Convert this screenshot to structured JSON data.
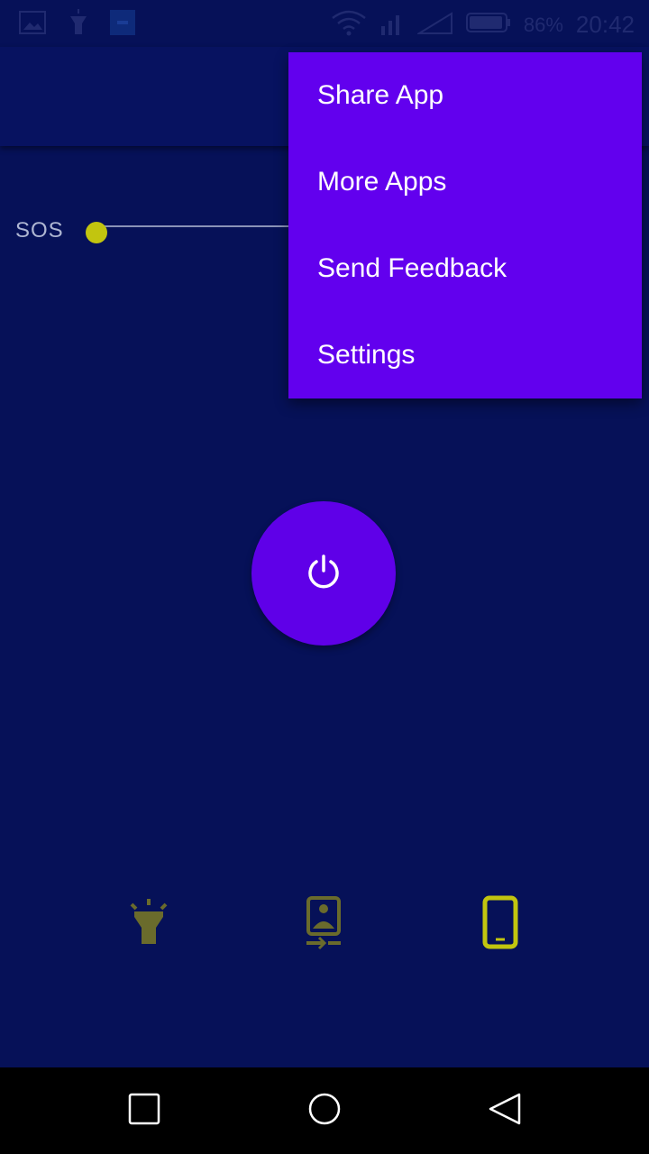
{
  "status_bar": {
    "battery_percent": "86%",
    "time": "20:42",
    "icons": [
      "image-icon",
      "flashlight-icon",
      "app-icon",
      "wifi-icon",
      "signal-icon",
      "signal-icon-2",
      "battery-icon"
    ]
  },
  "sos": {
    "label": "SOS",
    "slider_level": 0
  },
  "menu": {
    "items": [
      {
        "label": "Share App"
      },
      {
        "label": "More Apps"
      },
      {
        "label": "Send Feedback"
      },
      {
        "label": "Settings"
      }
    ]
  },
  "power_button": {
    "icon": "power-icon"
  },
  "bottom_tabs": [
    {
      "icon": "flashlight-icon",
      "active": false
    },
    {
      "icon": "front-camera-icon",
      "active": false
    },
    {
      "icon": "phone-screen-icon",
      "active": true
    }
  ],
  "nav_bar": {
    "icons": [
      "recents-icon",
      "home-icon",
      "back-icon"
    ]
  },
  "colors": {
    "background": "#061158",
    "menu": "#6200ee",
    "power_button": "#5f00e8",
    "accent_active": "#c2c50f",
    "accent_inactive": "#6a6b2c"
  }
}
